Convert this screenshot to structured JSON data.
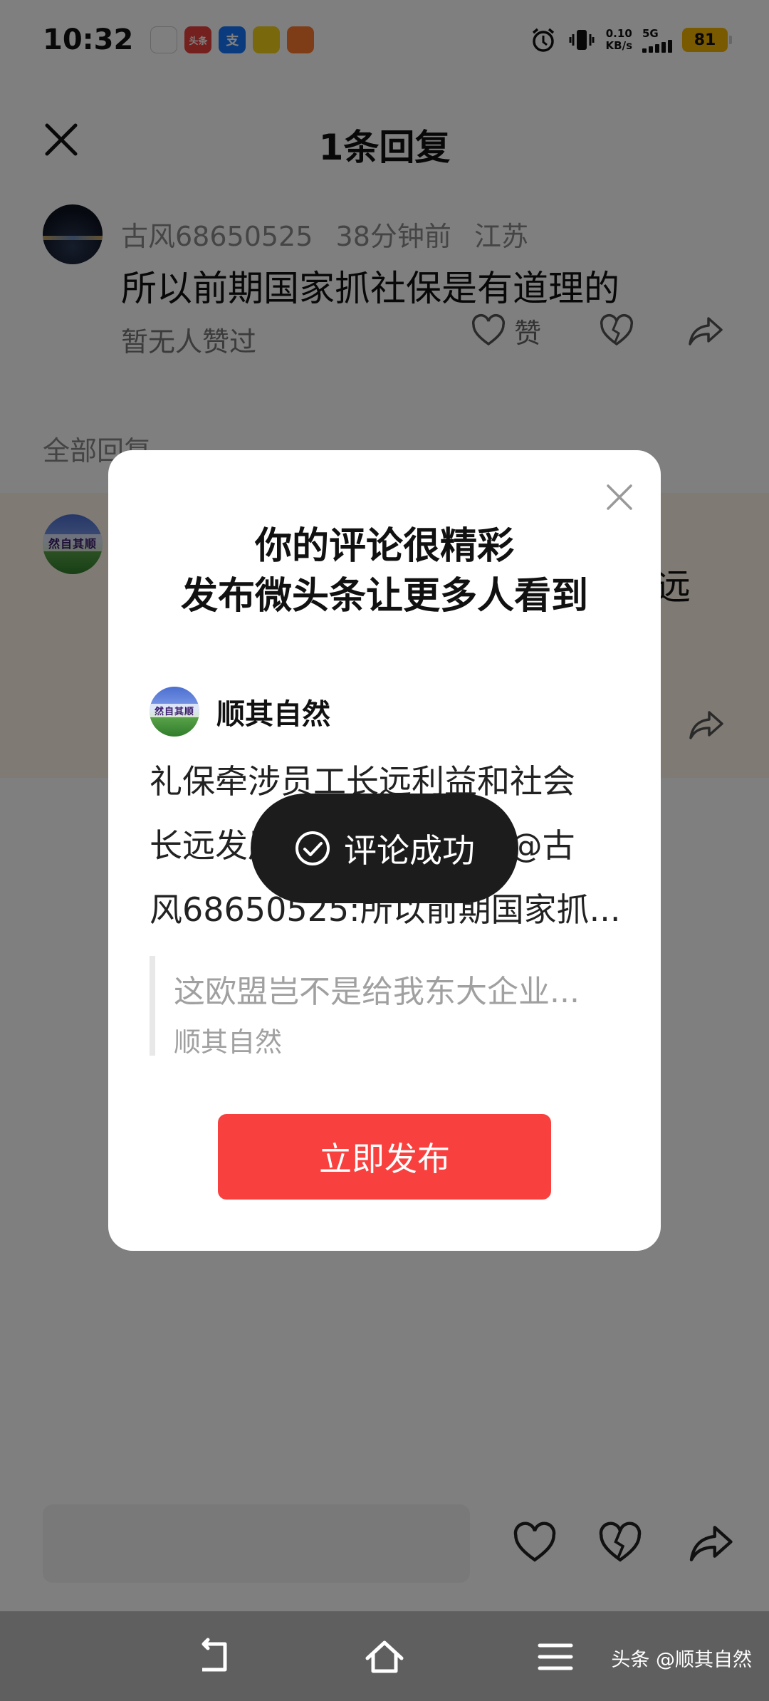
{
  "status_bar": {
    "time": "10:32",
    "apps": [
      {
        "name": "app-icon-1",
        "label": "",
        "color": "#ffffff"
      },
      {
        "name": "toutiao-app-icon",
        "label": "头条",
        "color": "#e8413c"
      },
      {
        "name": "alipay-app-icon",
        "label": "支",
        "color": "#1677ff"
      },
      {
        "name": "app-icon-4",
        "label": "",
        "color": "#f5d018"
      },
      {
        "name": "app-icon-5",
        "label": "",
        "color": "#ff7a2e"
      }
    ],
    "net_speed_value": "0.10",
    "net_speed_unit": "KB/s",
    "network": "5G",
    "battery": "81"
  },
  "sheet": {
    "title": "1条回复"
  },
  "comment": {
    "user": "古风68650525",
    "time": "38分钟前",
    "location": "江苏",
    "text": "所以前期国家抓社保是有道理的",
    "likes_text": "暂无人赞过",
    "like_label": "赞"
  },
  "all_replies_label": "全部回复",
  "reply_fragment": "远",
  "modal": {
    "title_line1": "你的评论很精彩",
    "title_line2": "发布微头条让更多人看到",
    "author": "顺其自然",
    "avatar_text": "然自其顺",
    "body_line1": "礼保牵涉员工长远利益和社会",
    "body_line2": "长远发展，和谐稳定。 //@古",
    "body_line3": "风68650525:所以前期国家抓...",
    "quote_text": "这欧盟岂不是给我东大企业...",
    "quote_author": "顺其自然",
    "publish_label": "立即发布"
  },
  "toast": {
    "text": "评论成功"
  },
  "watermark": "头条 @顺其自然",
  "colors": {
    "accent": "#f8413e",
    "battery": "#f5b400",
    "overlay": "rgba(0,0,0,0.5)"
  }
}
